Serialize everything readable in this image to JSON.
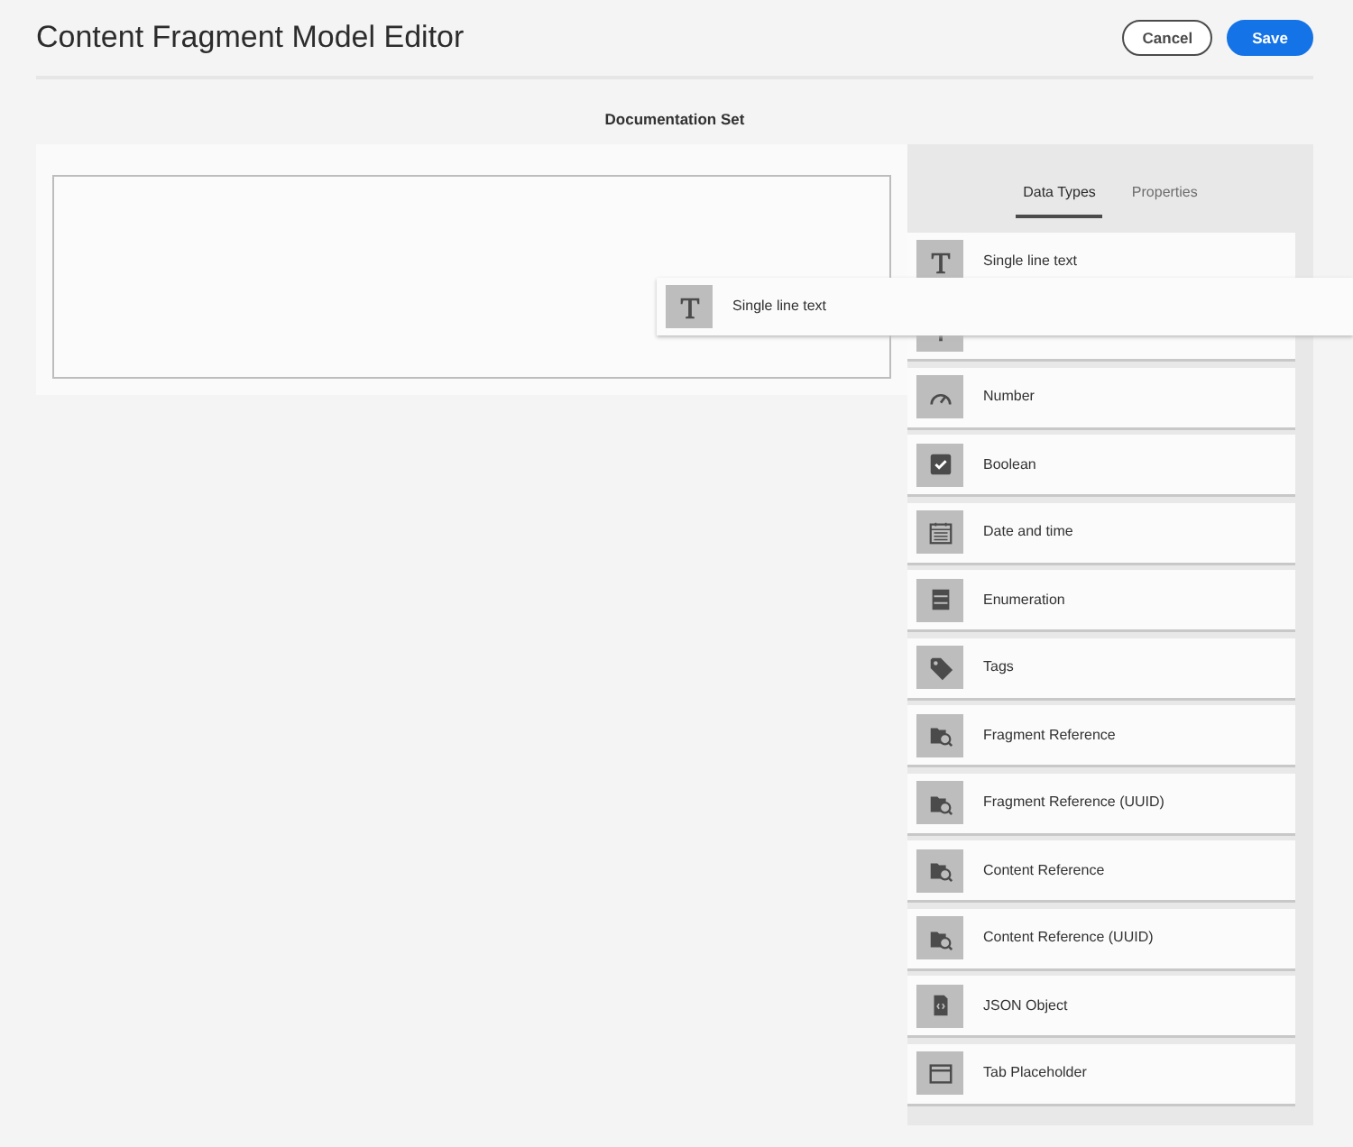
{
  "header": {
    "title": "Content Fragment Model Editor",
    "buttons": [
      {
        "label": "Cancel",
        "kind": "secondary"
      },
      {
        "label": "Save",
        "kind": "primary"
      }
    ]
  },
  "model_title": "Documentation Set",
  "tabs": [
    {
      "label": "Data Types",
      "selected": true
    },
    {
      "label": "Properties",
      "selected": false
    }
  ],
  "data_types": [
    {
      "kind": "text",
      "label": "Single line text"
    },
    {
      "kind": "multiline"
    },
    {
      "kind": "number",
      "label": "Number"
    },
    {
      "kind": "boolean",
      "label": "Boolean"
    },
    {
      "kind": "date",
      "label": "Date and time"
    },
    {
      "kind": "enum",
      "label": "Enumeration"
    },
    {
      "kind": "tag",
      "label": "Tags"
    },
    {
      "kind": "reference",
      "label": "Fragment Reference"
    },
    {
      "kind": "reference",
      "label": "Fragment Reference (UUID)"
    },
    {
      "kind": "reference",
      "label": "Content Reference"
    },
    {
      "kind": "reference",
      "label": "Content Reference (UUID)"
    },
    {
      "kind": "json",
      "label": "JSON Object"
    },
    {
      "kind": "tab",
      "label": "Tab Placeholder"
    }
  ],
  "dragged_item": {
    "kind": "text",
    "label": "Single line text"
  }
}
